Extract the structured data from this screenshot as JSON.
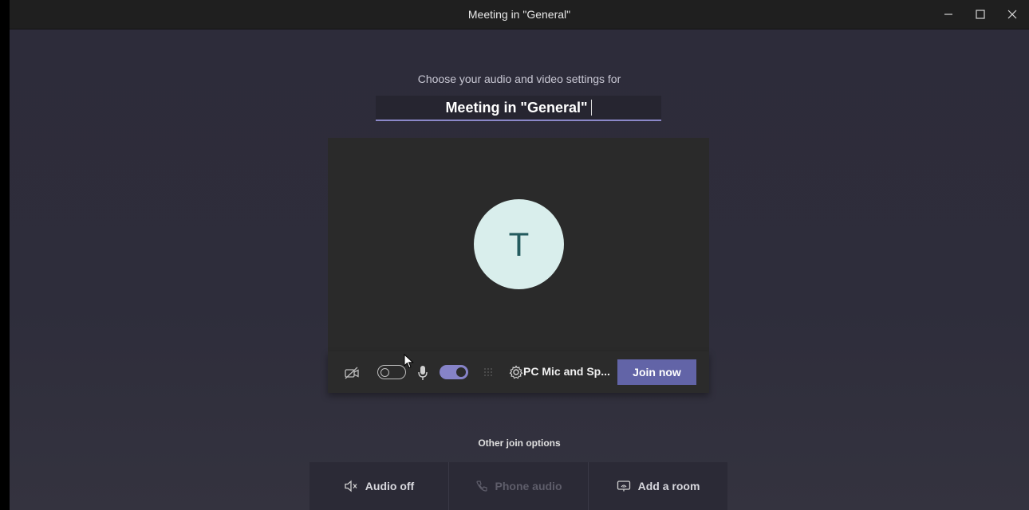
{
  "window": {
    "title": "Meeting in \"General\"",
    "controls": {
      "minimize": "minimize-icon",
      "maximize": "maximize-icon",
      "close": "close-icon"
    }
  },
  "prejoin": {
    "subtitle": "Choose your audio and video settings for",
    "meeting_name": "Meeting in \"General\"",
    "avatar_initial": "T",
    "camera_toggle": {
      "state": "off",
      "icon": "camera-off-icon"
    },
    "mic_toggle": {
      "state": "on",
      "icon": "microphone-icon"
    },
    "blur_icon": "background-blur-icon",
    "settings_icon": "gear-icon",
    "device_label": "PC Mic and Sp...",
    "join_label": "Join now"
  },
  "other_options": {
    "title": "Other join options",
    "items": [
      {
        "label": "Audio off",
        "icon": "speaker-off-icon",
        "enabled": true
      },
      {
        "label": "Phone audio",
        "icon": "phone-icon",
        "enabled": false
      },
      {
        "label": "Add a room",
        "icon": "cast-room-icon",
        "enabled": true
      }
    ]
  },
  "colors": {
    "accent": "#6264a7",
    "toggle_on": "#8683c8",
    "avatar_bg": "#d9eeec",
    "avatar_text": "#245b5e"
  }
}
